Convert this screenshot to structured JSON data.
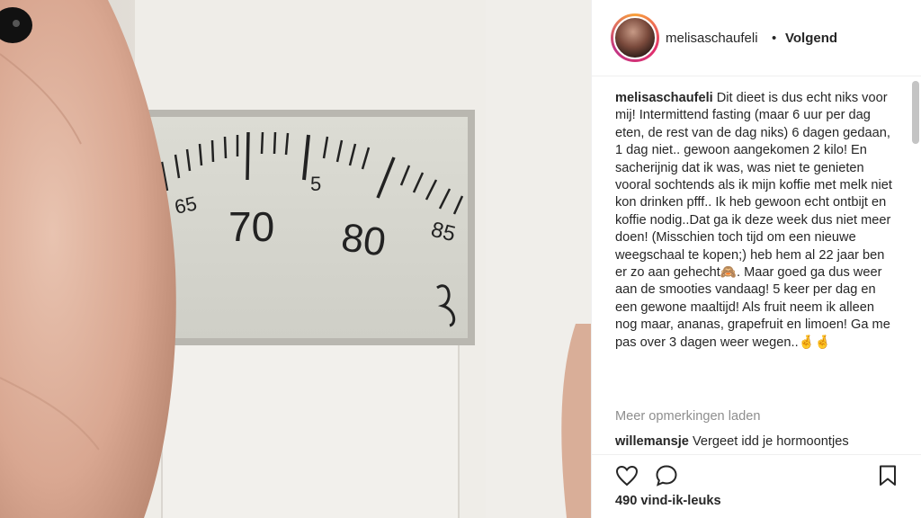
{
  "post": {
    "image_alt": "weegschaal",
    "scale_numbers": [
      "65",
      "70",
      "5",
      "80",
      "85"
    ]
  },
  "header": {
    "username": "melisaschaufeli",
    "separator": "•",
    "follow_status": "Volgend"
  },
  "caption": {
    "username": "melisaschaufeli",
    "text": "Dit dieet is dus echt niks voor mij! Intermittend fasting (maar 6 uur per dag eten, de rest van de dag niks) 6 dagen gedaan, 1 dag niet.. gewoon aangekomen 2 kilo! En sacherijnig dat ik was, was niet te genieten vooral sochtends als ik mijn koffie met melk niet kon drinken pfff.. Ik heb gewoon echt ontbijt en koffie nodig..Dat ga ik deze week dus niet meer doen! (Misschien toch tijd om een nieuwe weegschaal te kopen;) heb hem al 22 jaar ben er zo aan gehecht🙈. Maar goed ga dus weer aan de smooties vandaag! 5 keer per dag en een gewone maaltijd! Als fruit neem ik alleen nog maar, ananas, grapefruit en limoen! Ga me pas over 3 dagen weer wegen..🤞🤞"
  },
  "comments": {
    "load_more": "Meer opmerkingen laden",
    "first": {
      "username": "willemansje",
      "text": "Vergeet idd je hormoontjes"
    }
  },
  "actions": {
    "like_icon": "heart-icon",
    "comment_icon": "comment-icon",
    "save_icon": "bookmark-icon"
  },
  "likes": "490 vind-ik-leuks"
}
